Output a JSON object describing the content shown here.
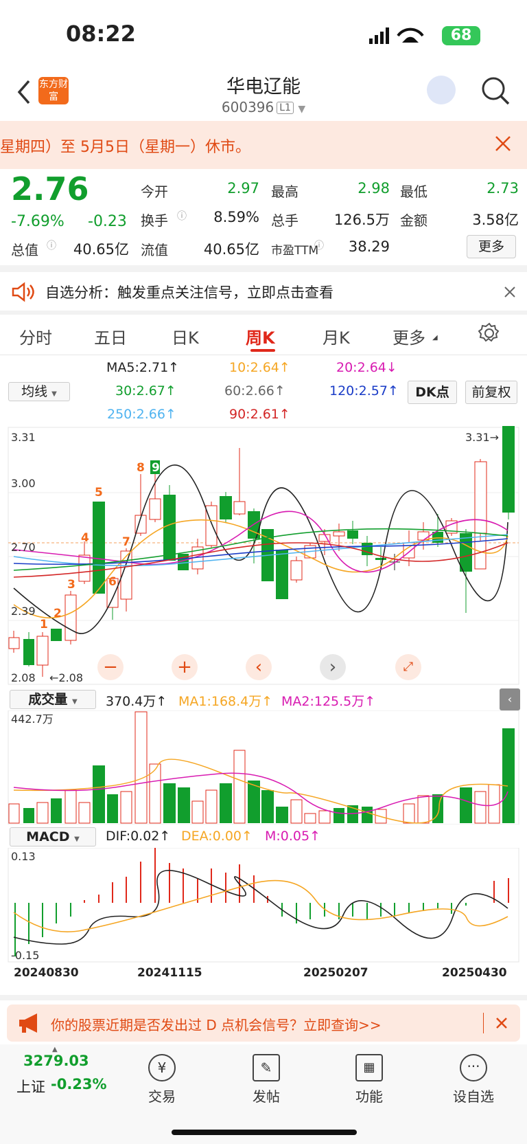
{
  "status": {
    "time": "08:22",
    "battery": "68"
  },
  "header": {
    "title": "华电辽能",
    "code": "600396",
    "level": "L1",
    "back_icon": "chevron-left-icon",
    "search_icon": "search-icon",
    "app_logo": "东方财富"
  },
  "banner": {
    "text": "星期四）至 5月5日（星期一）休市。"
  },
  "quote": {
    "price": "2.76",
    "pct": "-7.69%",
    "change": "-0.23",
    "open_label": "今开",
    "open": "2.97",
    "high_label": "最高",
    "high": "2.98",
    "low_label": "最低",
    "low": "2.73",
    "turnover_label": "换手",
    "turnover": "8.59%",
    "volume_label": "总手",
    "volume": "126.5万",
    "amount_label": "金额",
    "amount": "3.58亿",
    "mktcap_label": "总值",
    "mktcap": "40.65亿",
    "float_label": "流值",
    "float": "40.65亿",
    "pe_label": "市盈TTM",
    "pe": "38.29",
    "more": "更多"
  },
  "notice": {
    "text": "自选分析：触发重点关注信号，立即点击查看"
  },
  "tabs": [
    "分时",
    "五日",
    "日K",
    "周K",
    "月K",
    "更多"
  ],
  "active_tab": "周K",
  "ma": {
    "selector": "均线",
    "ma5": "MA5:2.71↑",
    "ma10": "10:2.64↑",
    "ma20": "20:2.64↓",
    "ma30": "30:2.67↑",
    "ma60": "60:2.66↑",
    "ma120": "120:2.57↑",
    "ma250": "250:2.66↑",
    "ma90": "90:2.61↑",
    "dk": "DK点",
    "adjust": "前复权"
  },
  "kline": {
    "y_labels": [
      "3.31",
      "3.00",
      "2.70",
      "2.39",
      "2.08"
    ],
    "max_marker": "3.31→",
    "min_marker": "←2.08",
    "signals": [
      "1",
      "2",
      "3",
      "4",
      "5",
      "6",
      "7",
      "8",
      "9"
    ]
  },
  "volume": {
    "selector": "成交量",
    "value": "370.4万↑",
    "ma1": "MA1:168.4万↑",
    "ma2": "MA2:125.5万↑",
    "max_label": "442.7万"
  },
  "macd": {
    "selector": "MACD",
    "dif": "DIF:0.02↑",
    "dea": "DEA:0.00↑",
    "m": "M:0.05↑",
    "top_label": "0.13",
    "bottom_label": "-0.15",
    "dates": [
      "20240830",
      "20241115",
      "20250207",
      "20250430"
    ]
  },
  "bottom_banner": {
    "text": "你的股票近期是否发出过 D 点机会信号？立即查询>>"
  },
  "nav": {
    "index_value": "3279.03",
    "index_name": "上证",
    "index_pct": "-0.23%",
    "items": [
      "交易",
      "发帖",
      "功能",
      "设自选"
    ]
  },
  "colors": {
    "up": "#e0281a",
    "down": "#119e2d",
    "accent": "#e04a14"
  }
}
